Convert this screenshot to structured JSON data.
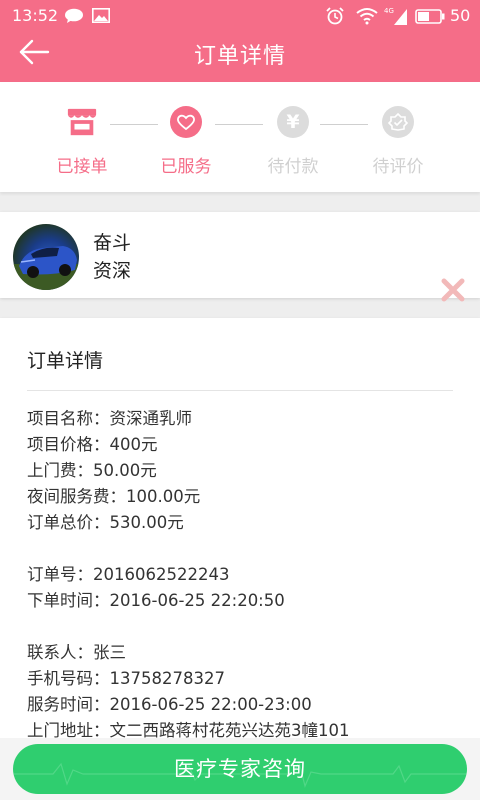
{
  "status_bar": {
    "time": "13:52",
    "battery": "50",
    "signal_label": "4G"
  },
  "header": {
    "title": "订单详情"
  },
  "progress": {
    "steps": [
      {
        "label": "已接单",
        "state": "active"
      },
      {
        "label": "已服务",
        "state": "active"
      },
      {
        "label": "待付款",
        "state": "inactive"
      },
      {
        "label": "待评价",
        "state": "inactive"
      }
    ],
    "yen_symbol": "¥"
  },
  "provider": {
    "name": "奋斗",
    "level": "资深"
  },
  "details": {
    "title": "订单详情",
    "rows": [
      "项目名称：资深通乳师",
      "项目价格：400元",
      "上门费：50.00元",
      "夜间服务费：100.00元",
      "订单总价：530.00元",
      "",
      "订单号：2016062522243",
      "下单时间：2016-06-25 22:20:50",
      "",
      "联系人：张三",
      "手机号码：13758278327",
      "服务时间：2016-06-25 22:00-23:00",
      "上门地址：文二西路蒋村花苑兴达苑3幢101"
    ]
  },
  "bottom": {
    "button_label": "医疗专家咨询"
  },
  "colors": {
    "brand": "#f56d88",
    "button": "#2fce6f",
    "inactive": "#dcdcdc"
  }
}
